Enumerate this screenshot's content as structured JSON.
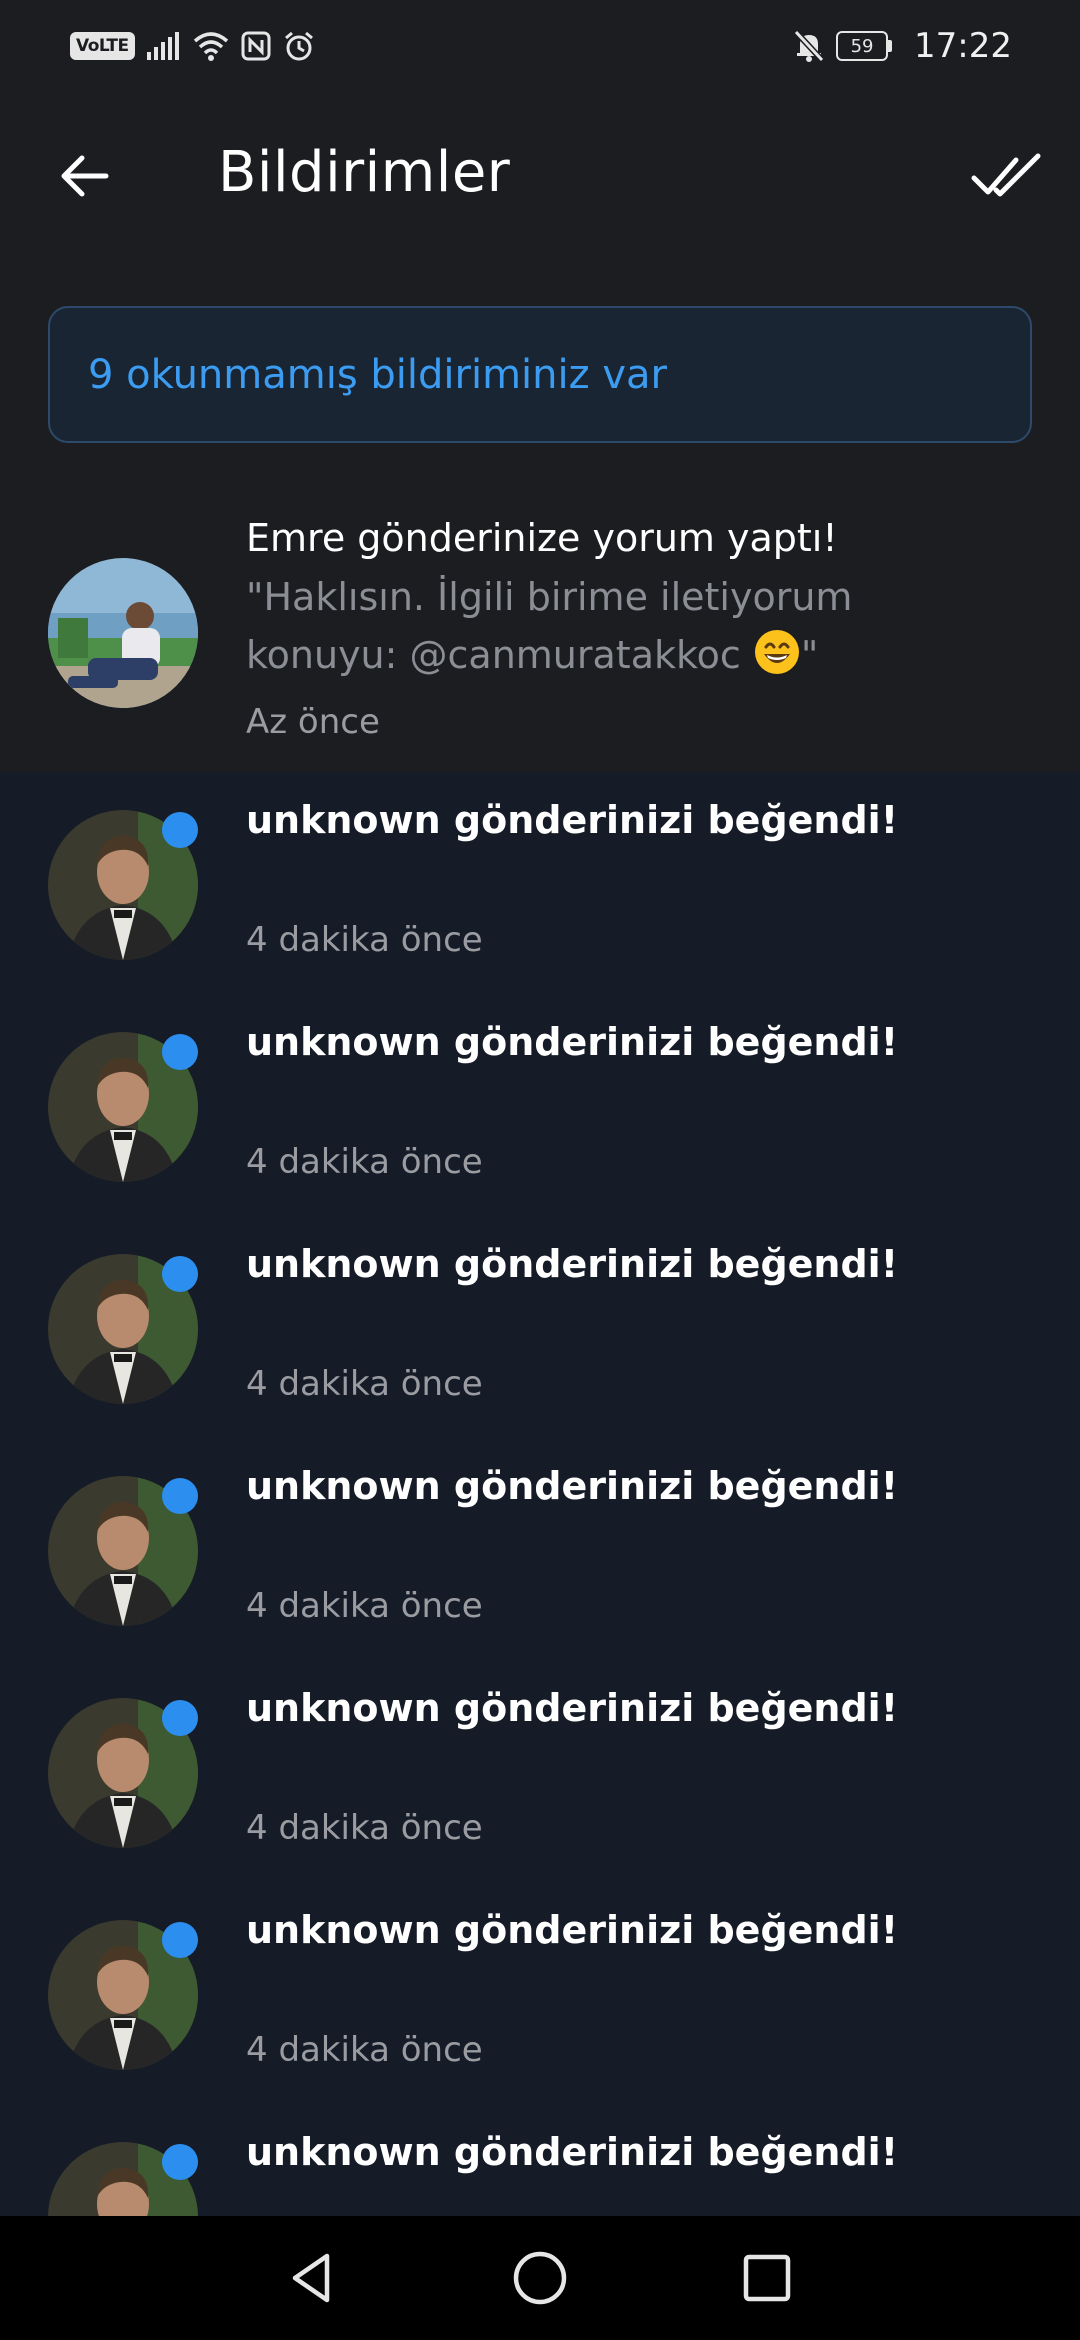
{
  "status_bar": {
    "volte": "VoLTE",
    "battery": "59",
    "time": "17:22",
    "icons": [
      "signal-icon",
      "wifi-icon",
      "nfc-icon",
      "alarm-icon",
      "mute-icon"
    ]
  },
  "header": {
    "title": "Bildirimler",
    "back_icon": "arrow-left-icon",
    "mark_all_icon": "double-check-icon"
  },
  "banner": {
    "text": "9 okunmamış bildiriminiz var"
  },
  "notifications": [
    {
      "title": "Emre gönderinize yorum yaptı!",
      "preview_line1": "\"Haklısın. İlgili birime iletiyorum",
      "preview_line2": "konuyu: @canmuratakkoc ",
      "preview_end": "\"",
      "time": "Az önce",
      "unread": false
    },
    {
      "title": "unknown gönderinizi beğendi!",
      "time": "4 dakika önce",
      "unread": true
    },
    {
      "title": "unknown gönderinizi beğendi!",
      "time": "4 dakika önce",
      "unread": true
    },
    {
      "title": "unknown gönderinizi beğendi!",
      "time": "4 dakika önce",
      "unread": true
    },
    {
      "title": "unknown gönderinizi beğendi!",
      "time": "4 dakika önce",
      "unread": true
    },
    {
      "title": "unknown gönderinizi beğendi!",
      "time": "4 dakika önce",
      "unread": true
    },
    {
      "title": "unknown gönderinizi beğendi!",
      "time": "4 dakika önce",
      "unread": true
    },
    {
      "title": "unknown gönderinizi beğendi!",
      "time": "",
      "unread": true
    }
  ],
  "colors": {
    "background": "#1c1d21",
    "unread_background": "#161c27",
    "accent": "#3b9cf2",
    "unread_dot": "#2c8ff0"
  }
}
